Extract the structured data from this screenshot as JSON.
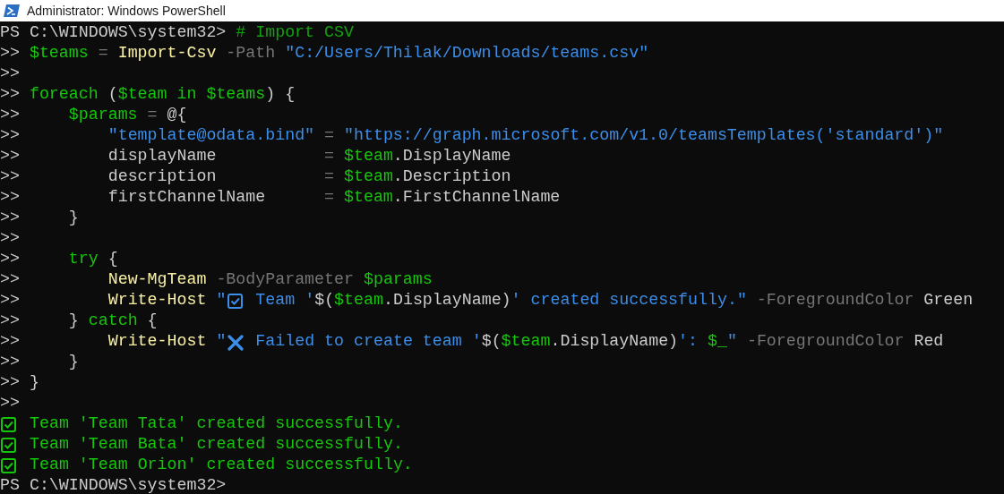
{
  "window": {
    "title": "Administrator: Windows PowerShell"
  },
  "console_lines": [
    [
      {
        "kind": "prompt",
        "text": "PS C:\\WINDOWS\\system32> "
      },
      {
        "kind": "comment",
        "text": "# Import CSV"
      }
    ],
    [
      {
        "kind": "prompt",
        "text": ">> "
      },
      {
        "kind": "variable",
        "text": "$teams"
      },
      {
        "kind": "operator",
        "text": " = "
      },
      {
        "kind": "command",
        "text": "Import-Csv"
      },
      {
        "kind": "parameter",
        "text": " -Path "
      },
      {
        "kind": "string",
        "text": "\"C:/Users/Thilak/Downloads/teams.csv\""
      }
    ],
    [
      {
        "kind": "prompt",
        "text": ">>"
      }
    ],
    [
      {
        "kind": "prompt",
        "text": ">> "
      },
      {
        "kind": "keyword",
        "text": "foreach"
      },
      {
        "kind": "plain",
        "text": " ("
      },
      {
        "kind": "variable",
        "text": "$team"
      },
      {
        "kind": "keyword",
        "text": " in "
      },
      {
        "kind": "variable",
        "text": "$teams"
      },
      {
        "kind": "plain",
        "text": ") {"
      }
    ],
    [
      {
        "kind": "prompt",
        "text": ">>     "
      },
      {
        "kind": "variable",
        "text": "$params"
      },
      {
        "kind": "operator",
        "text": " = "
      },
      {
        "kind": "plain",
        "text": "@{"
      }
    ],
    [
      {
        "kind": "prompt",
        "text": ">>         "
      },
      {
        "kind": "string",
        "text": "\"template@odata.bind\""
      },
      {
        "kind": "operator",
        "text": " = "
      },
      {
        "kind": "string",
        "text": "\"https://graph.microsoft.com/v1.0/teamsTemplates('standard')\""
      }
    ],
    [
      {
        "kind": "prompt",
        "text": ">>         "
      },
      {
        "kind": "plain",
        "text": "displayName"
      },
      {
        "kind": "operator",
        "text": "           = "
      },
      {
        "kind": "variable",
        "text": "$team"
      },
      {
        "kind": "plain",
        "text": ".DisplayName"
      }
    ],
    [
      {
        "kind": "prompt",
        "text": ">>         "
      },
      {
        "kind": "plain",
        "text": "description"
      },
      {
        "kind": "operator",
        "text": "           = "
      },
      {
        "kind": "variable",
        "text": "$team"
      },
      {
        "kind": "plain",
        "text": ".Description"
      }
    ],
    [
      {
        "kind": "prompt",
        "text": ">>         "
      },
      {
        "kind": "plain",
        "text": "firstChannelName"
      },
      {
        "kind": "operator",
        "text": "      = "
      },
      {
        "kind": "variable",
        "text": "$team"
      },
      {
        "kind": "plain",
        "text": ".FirstChannelName"
      }
    ],
    [
      {
        "kind": "prompt",
        "text": ">>     "
      },
      {
        "kind": "plain",
        "text": "}"
      }
    ],
    [
      {
        "kind": "prompt",
        "text": ">>"
      }
    ],
    [
      {
        "kind": "prompt",
        "text": ">>     "
      },
      {
        "kind": "keyword",
        "text": "try"
      },
      {
        "kind": "plain",
        "text": " {"
      }
    ],
    [
      {
        "kind": "prompt",
        "text": ">>         "
      },
      {
        "kind": "command",
        "text": "New-MgTeam"
      },
      {
        "kind": "parameter",
        "text": " -BodyParameter "
      },
      {
        "kind": "variable",
        "text": "$params"
      }
    ],
    [
      {
        "kind": "prompt",
        "text": ">>         "
      },
      {
        "kind": "command",
        "text": "Write-Host "
      },
      {
        "kind": "string",
        "text": "\""
      },
      {
        "kind": "check_icon"
      },
      {
        "kind": "string",
        "text": " Team '"
      },
      {
        "kind": "plain",
        "text": "$("
      },
      {
        "kind": "variable",
        "text": "$team"
      },
      {
        "kind": "plain",
        "text": ".DisplayName)"
      },
      {
        "kind": "string",
        "text": "' created successfully.\""
      },
      {
        "kind": "parameter",
        "text": " -ForegroundColor"
      },
      {
        "kind": "plain",
        "text": " Green"
      }
    ],
    [
      {
        "kind": "prompt",
        "text": ">>     "
      },
      {
        "kind": "plain",
        "text": "} "
      },
      {
        "kind": "keyword",
        "text": "catch"
      },
      {
        "kind": "plain",
        "text": " {"
      }
    ],
    [
      {
        "kind": "prompt",
        "text": ">>         "
      },
      {
        "kind": "command",
        "text": "Write-Host "
      },
      {
        "kind": "string",
        "text": "\""
      },
      {
        "kind": "cross_icon"
      },
      {
        "kind": "string",
        "text": " Failed to create team '"
      },
      {
        "kind": "plain",
        "text": "$("
      },
      {
        "kind": "variable",
        "text": "$team"
      },
      {
        "kind": "plain",
        "text": ".DisplayName)"
      },
      {
        "kind": "string",
        "text": "': "
      },
      {
        "kind": "variable",
        "text": "$_"
      },
      {
        "kind": "string",
        "text": "\""
      },
      {
        "kind": "parameter",
        "text": " -ForegroundColor"
      },
      {
        "kind": "plain",
        "text": " Red"
      }
    ],
    [
      {
        "kind": "prompt",
        "text": ">>     "
      },
      {
        "kind": "plain",
        "text": "}"
      }
    ],
    [
      {
        "kind": "prompt",
        "text": ">> "
      },
      {
        "kind": "plain",
        "text": "}"
      }
    ],
    [
      {
        "kind": "prompt",
        "text": ">>"
      }
    ],
    [
      {
        "kind": "done_icon"
      },
      {
        "kind": "output",
        "text": " Team 'Team Tata' created successfully."
      }
    ],
    [
      {
        "kind": "done_icon"
      },
      {
        "kind": "output",
        "text": " Team 'Team Bata' created successfully."
      }
    ],
    [
      {
        "kind": "done_icon"
      },
      {
        "kind": "output",
        "text": " Team 'Team Orion' created successfully."
      }
    ],
    [
      {
        "kind": "prompt",
        "text": "PS C:\\WINDOWS\\system32>"
      }
    ]
  ]
}
